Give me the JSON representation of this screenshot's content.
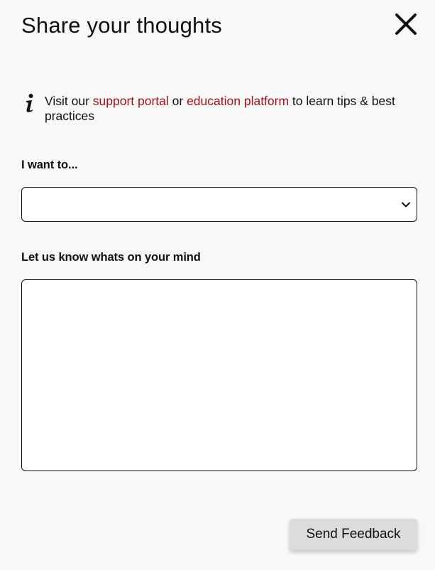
{
  "dialog": {
    "title": "Share your thoughts",
    "close_icon": "close-icon"
  },
  "info": {
    "icon": "info-icon",
    "prefix": "Visit our ",
    "link1": "support portal",
    "middle": " or ",
    "link2": "education platform",
    "suffix": " to learn tips & best practices"
  },
  "form": {
    "want_label": "I want to...",
    "want_value": "",
    "want_chevron": "chevron-down-icon",
    "mind_label": "Let us know whats on your mind",
    "mind_value": "",
    "mind_placeholder": ""
  },
  "actions": {
    "send_label": "Send Feedback"
  },
  "colors": {
    "link": "#a8111a",
    "background": "#f8f8f8",
    "button_bg": "#dcdcdc"
  }
}
